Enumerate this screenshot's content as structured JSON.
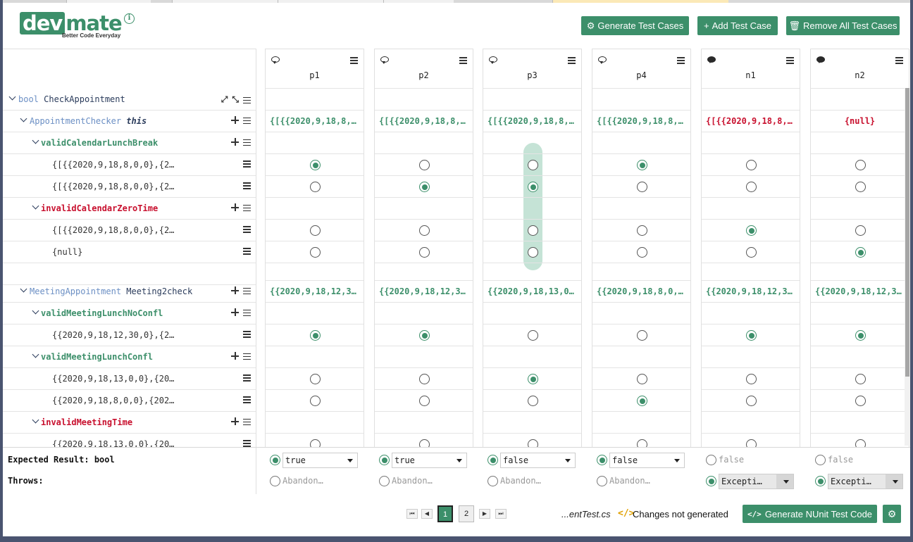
{
  "logo": {
    "part1": "dev",
    "part2": "mate",
    "tagline": "Better Code Everyday"
  },
  "header": {
    "generate_test_cases": "Generate Test Cases",
    "add_test_case": "Add Test Case",
    "remove_all": "Remove All Test Cases"
  },
  "tree": {
    "root": {
      "keyword": "bool",
      "name": "CheckAppointment"
    },
    "param1": {
      "type": "AppointmentChecker",
      "name": "this"
    },
    "p1_group1": "validCalendarLunchBreak",
    "p1_g1_v1": "{[{{2020,9,18,8,0,0},{2…",
    "p1_g1_v2": "{[{{2020,9,18,8,0,0},{2…",
    "p1_group2": "invalidCalendarZeroTime",
    "p1_g2_v1": "{[{{2020,9,18,8,0,0},{2…",
    "p1_g2_v2": "{null}",
    "param2": {
      "type": "MeetingAppointment",
      "name": "Meeting2check"
    },
    "p2_group1": "validMeetingLunchNoConfl",
    "p2_g1_v1": "{{2020,9,18,12,30,0},{2…",
    "p2_group2": "validMeetingLunchConfl",
    "p2_g2_v1": "{{2020,9,18,13,0,0},{20…",
    "p2_g2_v2": "{{2020,9,18,8,0,0},{202…",
    "p2_group3": "invalidMeetingTime",
    "p2_g3_v1": "{{2020,9,18,13,0,0},{20…"
  },
  "columns": [
    {
      "name": "p1",
      "this_val": "{[{{2020,9,18,8,…",
      "meeting_val": "{{2020,9,18,12,3…",
      "expected": "true",
      "throws": "Abandon…"
    },
    {
      "name": "p2",
      "this_val": "{[{{2020,9,18,8,…",
      "meeting_val": "{{2020,9,18,12,3…",
      "expected": "true",
      "throws": "Abandon…"
    },
    {
      "name": "p3",
      "this_val": "{[{{2020,9,18,8,…",
      "meeting_val": "{{2020,9,18,13,0…",
      "expected": "false",
      "throws": "Abandon…"
    },
    {
      "name": "p4",
      "this_val": "{[{{2020,9,18,8,…",
      "meeting_val": "{{2020,9,18,8,0,…",
      "expected": "false",
      "throws": "Abandon…"
    },
    {
      "name": "n1",
      "this_val": "{[{{2020,9,18,8,…",
      "meeting_val": "{{2020,9,18,12,3…",
      "expected": "false",
      "throws": "Excepti…"
    },
    {
      "name": "n2",
      "this_val": "{null}",
      "meeting_val": "{{2020,9,18,12,3…",
      "expected": "false",
      "throws": "Excepti…"
    }
  ],
  "bottom": {
    "expected_label": "Expected Result: bool",
    "throws_label": "Throws:"
  },
  "footer": {
    "page1": "1",
    "page2": "2",
    "filename": "...entTest.cs",
    "status": "Changes not generated",
    "generate_code": "Generate NUnit Test Code"
  },
  "colors": {
    "accent": "#3c8f6a",
    "error": "#c8102e",
    "type": "#6b8fc4"
  }
}
